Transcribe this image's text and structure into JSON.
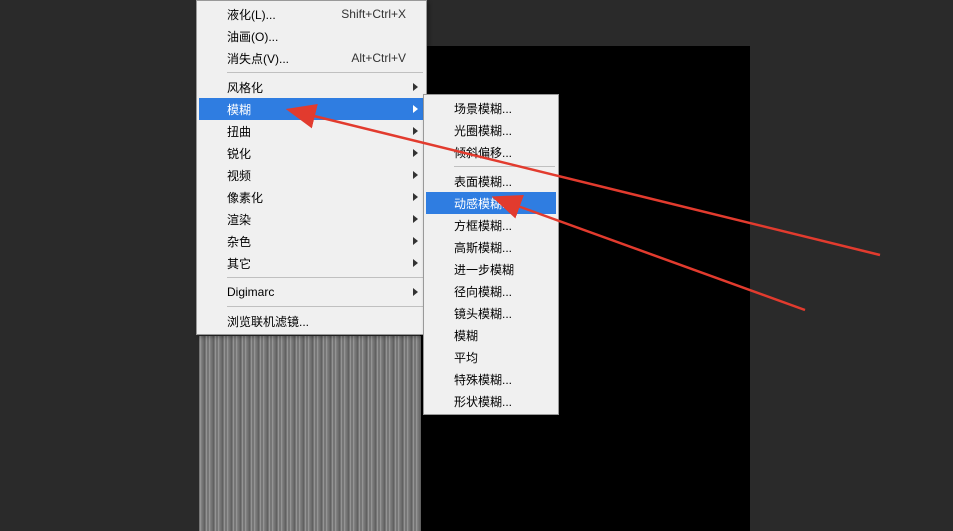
{
  "mainMenu": {
    "items": [
      {
        "label": "液化(L)...",
        "shortcut": "Shift+Ctrl+X"
      },
      {
        "label": "油画(O)...",
        "shortcut": ""
      },
      {
        "label": "消失点(V)...",
        "shortcut": "Alt+Ctrl+V"
      }
    ],
    "submenuGroup": [
      {
        "label": "风格化"
      },
      {
        "label": "模糊",
        "highlight": true
      },
      {
        "label": "扭曲"
      },
      {
        "label": "锐化"
      },
      {
        "label": "视频"
      },
      {
        "label": "像素化"
      },
      {
        "label": "渲染"
      },
      {
        "label": "杂色"
      },
      {
        "label": "其它"
      }
    ],
    "digimarc": {
      "label": "Digimarc"
    },
    "browse": {
      "label": "浏览联机滤镜..."
    }
  },
  "subMenu": {
    "group1": [
      {
        "label": "场景模糊..."
      },
      {
        "label": "光圈模糊..."
      },
      {
        "label": "倾斜偏移..."
      }
    ],
    "group2": [
      {
        "label": "表面模糊..."
      },
      {
        "label": "动感模糊...",
        "highlight": true
      },
      {
        "label": "方框模糊..."
      },
      {
        "label": "高斯模糊..."
      },
      {
        "label": "进一步模糊"
      },
      {
        "label": "径向模糊..."
      },
      {
        "label": "镜头模糊..."
      },
      {
        "label": "模糊"
      },
      {
        "label": "平均"
      },
      {
        "label": "特殊模糊..."
      },
      {
        "label": "形状模糊..."
      }
    ]
  },
  "annotations": {
    "arrowColor": "#e23b2e"
  }
}
